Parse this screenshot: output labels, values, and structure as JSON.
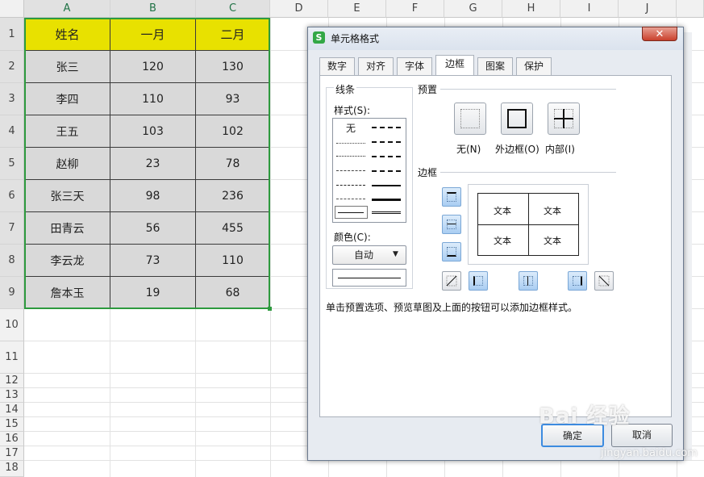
{
  "spreadsheet": {
    "columns": [
      "A",
      "B",
      "C",
      "D",
      "E",
      "F",
      "G",
      "H",
      "I",
      "J"
    ],
    "rows": [
      "1",
      "2",
      "3",
      "4",
      "5",
      "6",
      "7",
      "8",
      "9",
      "10",
      "11",
      "12",
      "13",
      "14",
      "15",
      "16",
      "17",
      "18"
    ],
    "header_cells": [
      "姓名",
      "一月",
      "二月"
    ],
    "data_rows": [
      [
        "张三",
        "120",
        "130"
      ],
      [
        "李四",
        "110",
        "93"
      ],
      [
        "王五",
        "103",
        "102"
      ],
      [
        "赵柳",
        "23",
        "78"
      ],
      [
        "张三天",
        "98",
        "236"
      ],
      [
        "田青云",
        "56",
        "455"
      ],
      [
        "李云龙",
        "73",
        "110"
      ],
      [
        "詹本玉",
        "19",
        "68"
      ]
    ],
    "colors": {
      "header_fill": "#e8e100",
      "data_fill": "#d9d9d9",
      "selection": "#2d9a3e"
    }
  },
  "dialog": {
    "title": "单元格格式",
    "close_symbol": "✕",
    "tabs": [
      "数字",
      "对齐",
      "字体",
      "边框",
      "图案",
      "保护"
    ],
    "active_tab": "边框",
    "line_group": {
      "title": "线条",
      "style_label": "样式(S):",
      "style_none": "无",
      "color_label": "颜色(C):",
      "color_value": "自动"
    },
    "preset_group": {
      "title": "预置",
      "buttons": [
        "无(N)",
        "外边框(O)",
        "内部(I)"
      ]
    },
    "border_group": {
      "title": "边框",
      "preview_text": [
        "文本",
        "文本",
        "文本",
        "文本"
      ]
    },
    "hint": "单击预置选项、预览草图及上面的按钮可以添加边框样式。",
    "ok_label": "确定",
    "cancel_label": "取消"
  },
  "watermark": {
    "text": "Bai 经验",
    "url_text": "jingyan.baidu.com"
  }
}
